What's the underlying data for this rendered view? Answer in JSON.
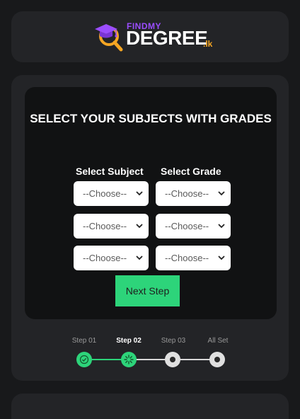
{
  "logo": {
    "findmy": "FINDMY",
    "degree": "DEGREE",
    "tld": ".lk"
  },
  "form": {
    "title": "SELECT YOUR SUBJECTS WITH GRADES",
    "subject_header": "Select Subject",
    "grade_header": "Select Grade",
    "rows": [
      {
        "subject": "--Choose--",
        "grade": "--Choose--"
      },
      {
        "subject": "--Choose--",
        "grade": "--Choose--"
      },
      {
        "subject": "--Choose--",
        "grade": "--Choose--"
      }
    ],
    "next_label": "Next Step"
  },
  "steps": [
    {
      "label": "Step 01",
      "state": "done"
    },
    {
      "label": "Step 02",
      "state": "current"
    },
    {
      "label": "Step 03",
      "state": "upcoming"
    },
    {
      "label": "All Set",
      "state": "upcoming"
    }
  ],
  "colors": {
    "accent_green": "#2dd47a",
    "brand_purple": "#9b4dff",
    "brand_orange": "#f5a623"
  }
}
